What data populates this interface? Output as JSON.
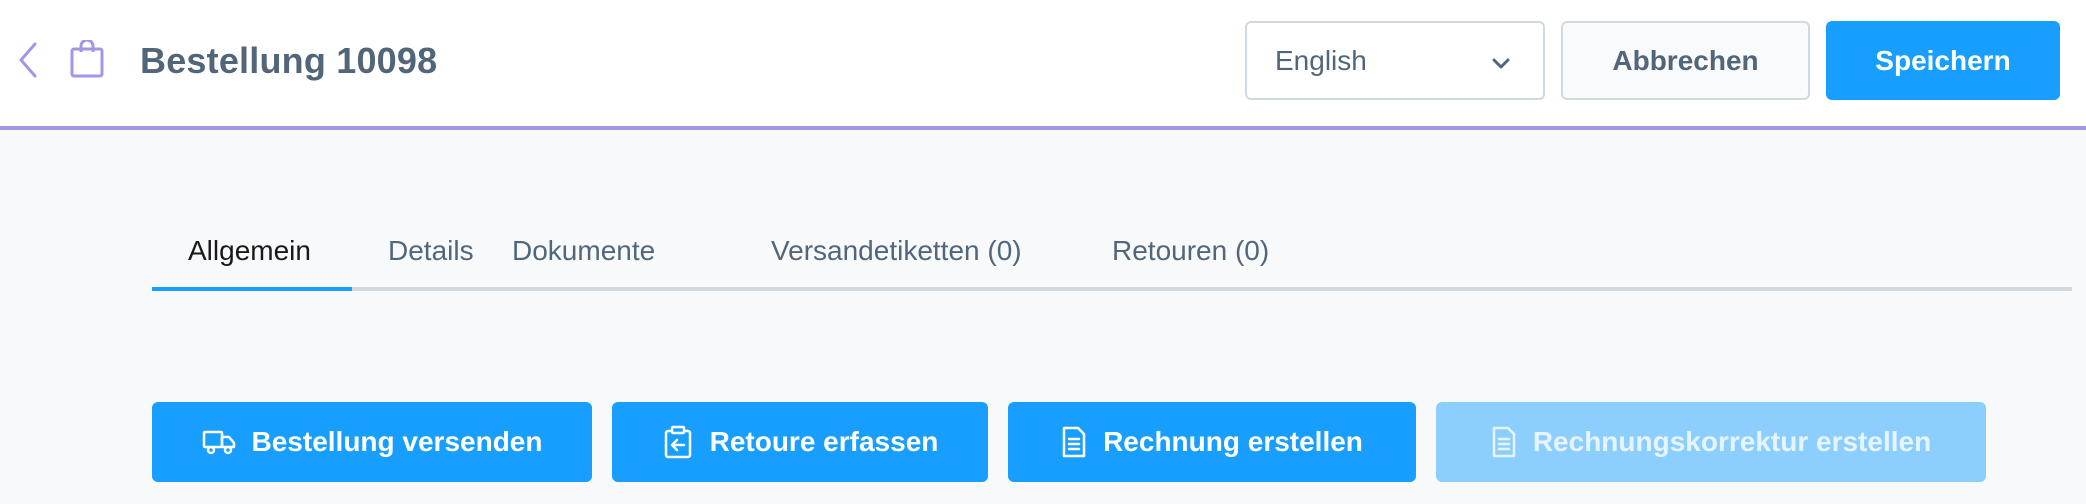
{
  "header": {
    "title": "Bestellung 10098",
    "language": {
      "selected": "English"
    },
    "cancel_label": "Abbrechen",
    "save_label": "Speichern"
  },
  "tabs": [
    {
      "label": "Allgemein",
      "active": true
    },
    {
      "label": "Details",
      "active": false
    },
    {
      "label": "Dokumente",
      "active": false
    },
    {
      "label": "Versandetiketten (0)",
      "active": false
    },
    {
      "label": "Retouren (0)",
      "active": false
    }
  ],
  "actions": [
    {
      "label": "Bestellung versenden",
      "icon": "truck-icon",
      "enabled": true
    },
    {
      "label": "Retoure erfassen",
      "icon": "return-icon",
      "enabled": true
    },
    {
      "label": "Rechnung erstellen",
      "icon": "document-icon",
      "enabled": true
    },
    {
      "label": "Rechnungskorrektur erstellen",
      "icon": "document-icon",
      "enabled": false
    }
  ],
  "colors": {
    "primary": "#189eff",
    "primary_disabled": "#8ccfff",
    "header_accent": "#a396e6",
    "text": "#52667a"
  }
}
